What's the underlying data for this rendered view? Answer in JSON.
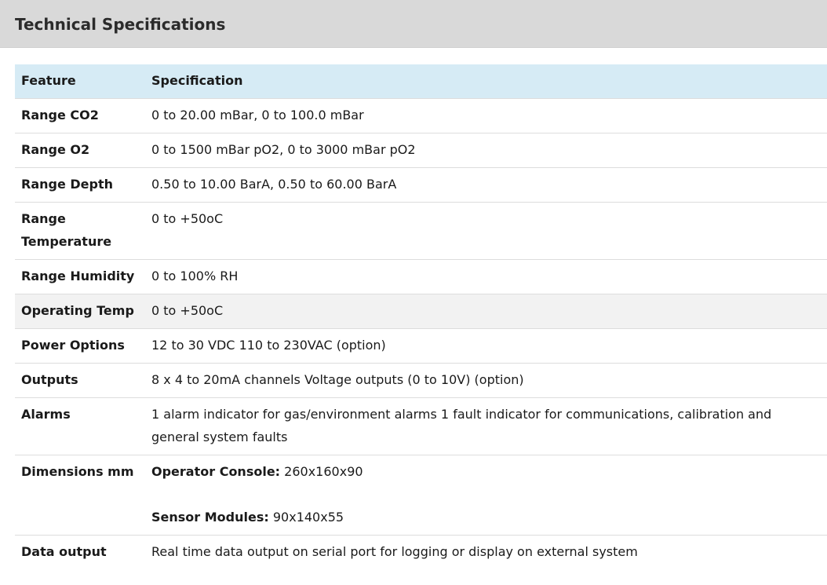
{
  "page": {
    "title": "Technical Specifications"
  },
  "table": {
    "headers": {
      "feature": "Feature",
      "specification": "Specification"
    },
    "rows": [
      {
        "feature": "Range CO2",
        "spec": "0 to 20.00 mBar, 0 to 100.0 mBar"
      },
      {
        "feature": "Range O2",
        "spec": "0 to 1500 mBar pO2, 0 to 3000 mBar pO2"
      },
      {
        "feature": "Range Depth",
        "spec": "0.50 to 10.00 BarA, 0.50 to 60.00 BarA"
      },
      {
        "feature": "Range Temperature",
        "spec": "0 to +50oC"
      },
      {
        "feature": "Range Humidity",
        "spec": "0 to 100% RH"
      },
      {
        "feature": "Operating Temp",
        "spec": "0 to +50oC"
      },
      {
        "feature": "Power Options",
        "spec": "12 to 30 VDC 110 to 230VAC (option)"
      },
      {
        "feature": "Outputs",
        "spec": "8 x 4 to 20mA channels Voltage outputs (0 to 10V) (option)"
      },
      {
        "feature": "Alarms",
        "spec": "1 alarm indicator for gas/environment alarms 1 fault indicator for communications, calibration and general system faults"
      },
      {
        "feature": "Dimensions mm",
        "spec_items": [
          {
            "label": "Operator Console:",
            "value": "260x160x90"
          },
          {
            "label": "Sensor Modules:",
            "value": "90x140x55"
          }
        ]
      },
      {
        "feature": "Data output",
        "spec": "Real time data output on serial port for logging or display on external system"
      }
    ]
  }
}
